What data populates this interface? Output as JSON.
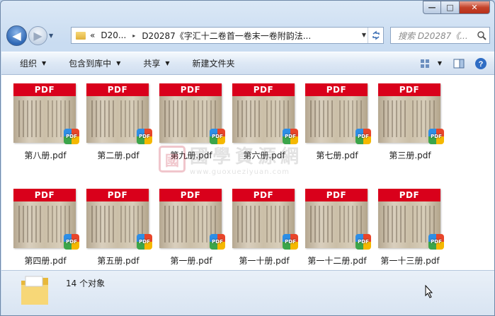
{
  "window": {
    "minimize_glyph": "—",
    "maximize_glyph": "□",
    "close_glyph": "✕"
  },
  "nav": {
    "back_glyph": "◀",
    "forward_glyph": "▶",
    "dropdown_glyph": "▼"
  },
  "address": {
    "prefix": "«",
    "crumb1": "D20...",
    "crumb2": "D20287《字汇十二卷首一卷末一卷附韵法...",
    "separator": "▸"
  },
  "search": {
    "placeholder": "搜索 D20287《..."
  },
  "toolbar": {
    "organize": "组织",
    "include_in_library": "包含到库中",
    "share": "共享",
    "new_folder": "新建文件夹"
  },
  "files": [
    {
      "name": "第八册.pdf",
      "badge": "PDF"
    },
    {
      "name": "第二册.pdf",
      "badge": "PDF"
    },
    {
      "name": "第九册.pdf",
      "badge": "PDF"
    },
    {
      "name": "第六册.pdf",
      "badge": "PDF"
    },
    {
      "name": "第七册.pdf",
      "badge": "PDF"
    },
    {
      "name": "第三册.pdf",
      "badge": "PDF"
    },
    {
      "name": "第四册.pdf",
      "badge": "PDF"
    },
    {
      "name": "第五册.pdf",
      "badge": "PDF"
    },
    {
      "name": "第一册.pdf",
      "badge": "PDF"
    },
    {
      "name": "第一十册.pdf",
      "badge": "PDF"
    },
    {
      "name": "第一十二册.pdf",
      "badge": "PDF"
    },
    {
      "name": "第一十三册.pdf",
      "badge": "PDF"
    }
  ],
  "watermark": {
    "seal": "國",
    "text": "國學資源網",
    "url": "www.guoxueziyuan.com"
  },
  "status": {
    "count_text": "14 个对象"
  },
  "icons": {
    "back": "back-arrow-icon",
    "forward": "forward-arrow-icon",
    "folder": "folder-icon",
    "refresh": "refresh-icon",
    "search": "magnifier-icon",
    "view": "view-options-icon",
    "preview_pane": "preview-pane-icon",
    "help": "help-icon"
  }
}
